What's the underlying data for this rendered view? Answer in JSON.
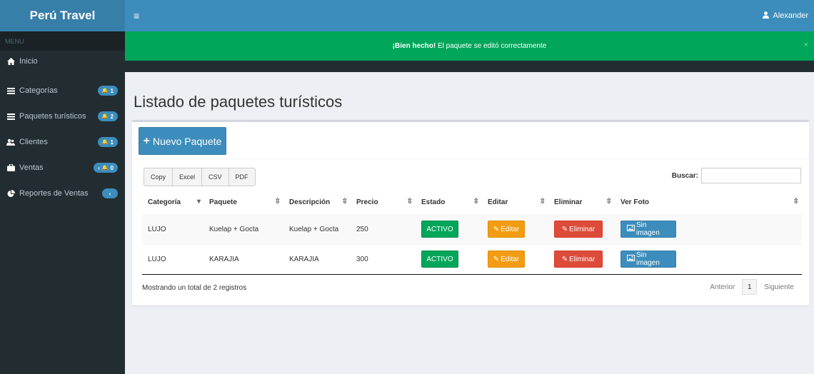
{
  "app": {
    "title": "Perú Travel"
  },
  "topbar": {
    "user": "Alexander",
    "menu_icon": "hamburger-icon",
    "user_icon": "user-icon"
  },
  "sidebar": {
    "header": "MENU",
    "items": [
      {
        "label": "Inicio",
        "icon": "home-icon",
        "badge": null
      },
      {
        "label": "Categorías",
        "icon": "list-icon",
        "badge": "1"
      },
      {
        "label": "Paquetes turísticos",
        "icon": "list-icon",
        "badge": "2"
      },
      {
        "label": "Clientes",
        "icon": "users-icon",
        "badge": "1"
      },
      {
        "label": "Ventas",
        "icon": "briefcase-icon",
        "badge": "0"
      },
      {
        "label": "Reportes de Ventas",
        "icon": "pie-chart-icon",
        "badge": null
      }
    ]
  },
  "alert": {
    "strong": "¡Bien hecho!",
    "text": " El paquete se editó correctamente",
    "close": "×"
  },
  "page": {
    "title": "Listado de paquetes turísticos"
  },
  "toolbar": {
    "new_label": "Nuevo Paquete"
  },
  "export": [
    "Copy",
    "Excel",
    "CSV",
    "PDF"
  ],
  "search": {
    "label": "Buscar:",
    "value": ""
  },
  "table": {
    "columns": [
      "Categoría",
      "Paquete",
      "Descripción",
      "Precio",
      "Estado",
      "Editar",
      "Eliminar",
      "Ver Foto"
    ],
    "rows": [
      {
        "categoria": "LUJO",
        "paquete": "Kuelap + Gocta",
        "descripcion": "Kuelap + Gocta",
        "precio": "250",
        "estado": "ACTIVO",
        "editar": "Editar",
        "eliminar": "Eliminar",
        "foto": "Sin imagen"
      },
      {
        "categoria": "LUJO",
        "paquete": "KARAJIA",
        "descripcion": "KARAJIA",
        "precio": "300",
        "estado": "ACTIVO",
        "editar": "Editar",
        "eliminar": "Eliminar",
        "foto": "Sin imagen"
      }
    ]
  },
  "footer": {
    "info": "Mostrando un total de 2 registros",
    "prev": "Anterior",
    "page": "1",
    "next": "Siguiente"
  },
  "colors": {
    "primary": "#3c8dbc",
    "success": "#00a65a",
    "warning": "#f39c12",
    "danger": "#dd4b39",
    "sidebar": "#222d32"
  }
}
